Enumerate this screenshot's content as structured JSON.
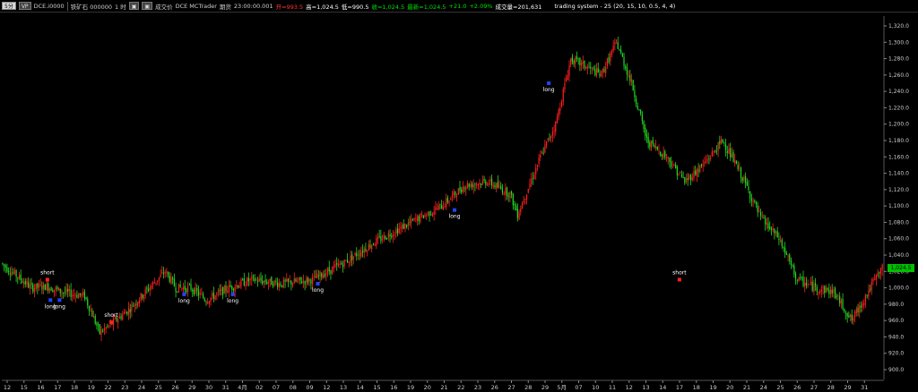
{
  "toolbar": {
    "btn1": "5分",
    "btn2": "VP",
    "symbol": "DCE.i0000",
    "name": "铁矿石 000000",
    "interval": "1 时",
    "tb_icon1": "▣",
    "tb_icon2": "▣",
    "tb_label": "成交价",
    "exchange": "DCE  MCTrader",
    "session": "期货",
    "time": "23:00:00.001",
    "open": "开=993.5",
    "high": "高=1,024.5",
    "low": "低=990.5",
    "close": "收=1,024.5",
    "last": "最新=1,024.5",
    "change": "+21.0",
    "change_pct": "+2.09%",
    "volume": "成交量=201,631",
    "strategy": "trading system - 25 (20, 15, 10, 0.5, 4, 4)"
  },
  "colors": {
    "background": "#000000",
    "up": "#ff2020",
    "down": "#22dd22",
    "grid": "#333333",
    "last_tag": "#00c000",
    "signal_long": "#2244ff",
    "signal_short": "#ff2222"
  },
  "chart_data": {
    "type": "candlestick",
    "y_ticks": [
      "1,320.0",
      "1,300.0",
      "1,280.0",
      "1,260.0",
      "1,240.0",
      "1,220.0",
      "1,200.0",
      "1,180.0",
      "1,160.0",
      "1,140.0",
      "1,120.0",
      "1,100.0",
      "1,080.0",
      "1,060.0",
      "1,040.0",
      "1,020.0",
      "1,000.0",
      "980.0",
      "960.0",
      "940.0",
      "920.0",
      "900.0"
    ],
    "ylim": [
      888,
      1332
    ],
    "last_price_label": "1,024.5",
    "last_price": 1024.5,
    "x_labels": [
      "12",
      "15",
      "16",
      "17",
      "18",
      "19",
      "22",
      "23",
      "24",
      "25",
      "26",
      "29",
      "30",
      "31",
      "4月",
      "02",
      "07",
      "08",
      "09",
      "12",
      "13",
      "14",
      "15",
      "16",
      "19",
      "20",
      "21",
      "22",
      "23",
      "26",
      "27",
      "28",
      "29",
      "5月",
      "07",
      "10",
      "11",
      "12",
      "13",
      "14",
      "17",
      "18",
      "19",
      "20",
      "21",
      "24",
      "25",
      "26",
      "27",
      "28",
      "29",
      "31"
    ],
    "signals": [
      {
        "label": "short",
        "bar": 30,
        "price": 1010,
        "side": "above"
      },
      {
        "label": "long",
        "bar": 32,
        "price": 985,
        "side": "below"
      },
      {
        "label": "long",
        "bar": 38,
        "price": 985,
        "side": "below"
      },
      {
        "label": "short",
        "bar": 72,
        "price": 958,
        "side": "above"
      },
      {
        "label": "long",
        "bar": 120,
        "price": 992,
        "side": "below"
      },
      {
        "label": "long",
        "bar": 152,
        "price": 992,
        "side": "below"
      },
      {
        "label": "long",
        "bar": 208,
        "price": 1005,
        "side": "below"
      },
      {
        "label": "long",
        "bar": 298,
        "price": 1095,
        "side": "below"
      },
      {
        "label": "long",
        "bar": 360,
        "price": 1250,
        "side": "below"
      },
      {
        "label": "short",
        "bar": 446,
        "price": 1010,
        "side": "above"
      }
    ]
  }
}
